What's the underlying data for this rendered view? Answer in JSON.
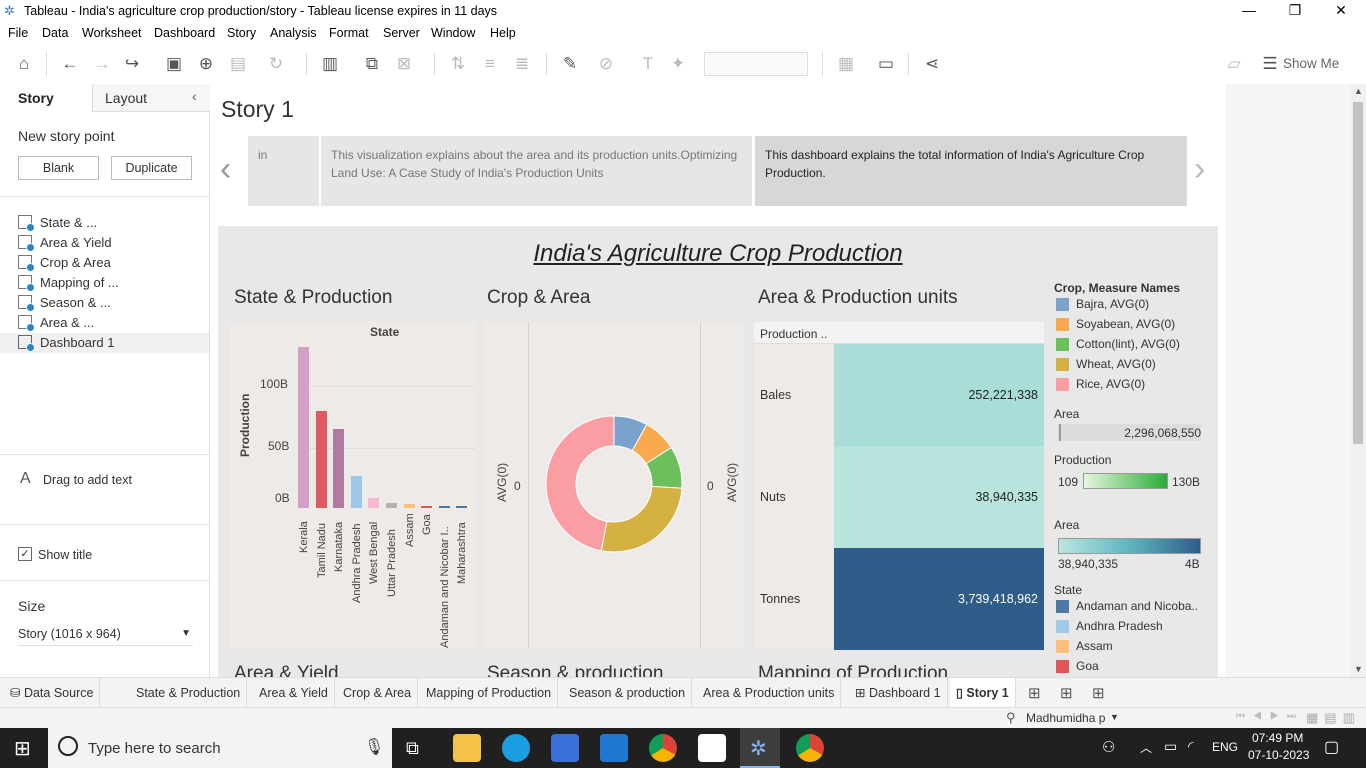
{
  "window": {
    "title": "Tableau - India's agriculture crop production/story - Tableau license expires in 11 days"
  },
  "menu": [
    "File",
    "Data",
    "Worksheet",
    "Dashboard",
    "Story",
    "Analysis",
    "Format",
    "Server",
    "Window",
    "Help"
  ],
  "toolbar": {
    "show_me": "Show Me"
  },
  "left_panel": {
    "tab_story": "Story",
    "tab_layout": "Layout",
    "new_story_point": "New story point",
    "blank_button": "Blank",
    "duplicate_button": "Duplicate",
    "sheets": [
      "State & ...",
      "Area & Yield",
      "Crop & Area",
      "Mapping of ...",
      "Season & ...",
      "Area & ...",
      "Dashboard 1"
    ],
    "drag_text": "Drag to add text",
    "show_title": "Show title",
    "size_label": "Size",
    "size_value": "Story (1016 x 964)"
  },
  "story": {
    "title": "Story 1",
    "caption_partial": "in",
    "caption_2": "This visualization explains about the area and its production units.Optimizing Land Use: A Case Study of India's Production Units",
    "caption_3": "This dashboard explains the total information of India's Agriculture Crop Production."
  },
  "dashboard": {
    "title": "India's Agriculture Crop Production",
    "sheet1_title": "State & Production",
    "sheet2_title": "Crop & Area",
    "sheet3_title": "Area & Production units",
    "bottom_titles": [
      "Area & Yield",
      "Season & production",
      "Mapping of Production"
    ]
  },
  "chart_data": [
    {
      "type": "bar",
      "title": "State & Production",
      "header": "State",
      "ylabel": "Production",
      "yticks": [
        "100B",
        "50B",
        "0B"
      ],
      "ylim": [
        0,
        130
      ],
      "categories": [
        "Kerala",
        "Tamil Nadu",
        "Karnataka",
        "Andhra Pradesh",
        "West Bengal",
        "Uttar Pradesh",
        "Assam",
        "Goa",
        "Andaman and Nicobar I..",
        "Maharashtra"
      ],
      "values": [
        129,
        78,
        63,
        26,
        8,
        4,
        3,
        2,
        2,
        1
      ],
      "colors": [
        "#d4a0c8",
        "#e05a64",
        "#b07aa1",
        "#9dc7e8",
        "#f7b6d2",
        "#bab0ac",
        "#ffbe7d",
        "#e15759",
        "#4e79a7",
        "#4e79a7"
      ]
    },
    {
      "type": "pie",
      "title": "Crop & Area",
      "axis_left": "AVG(0)",
      "axis_right": "AVG(0)",
      "zero_left": "0",
      "zero_right": "0",
      "categories": [
        "Bajra",
        "Soyabean",
        "Cotton(lint)",
        "Wheat",
        "Rice"
      ],
      "values": [
        8,
        8,
        10,
        27,
        47
      ],
      "colors": [
        "#7aa3cc",
        "#f9a94e",
        "#6cbf5c",
        "#d5b043",
        "#fb9ea4"
      ]
    },
    {
      "type": "table",
      "title": "Area & Production units",
      "header": "Production ..",
      "rows": [
        {
          "label": "Bales",
          "value": "252,221,338",
          "color": "#a9ded8"
        },
        {
          "label": "Nuts",
          "value": "38,940,335",
          "color": "#b7e4dc"
        },
        {
          "label": "Tonnes",
          "value": "3,739,418,962",
          "color": "#2f5d8a"
        }
      ]
    }
  ],
  "legends": {
    "crop_title": "Crop, Measure Names",
    "crop_items": [
      {
        "label": "Bajra, AVG(0)",
        "color": "#7aa3cc"
      },
      {
        "label": "Soyabean, AVG(0)",
        "color": "#f9a94e"
      },
      {
        "label": "Cotton(lint), AVG(0)",
        "color": "#6cbf5c"
      },
      {
        "label": "Wheat, AVG(0)",
        "color": "#d5b043"
      },
      {
        "label": "Rice, AVG(0)",
        "color": "#fb9ea4"
      }
    ],
    "area_title": "Area",
    "area_value": "2,296,068,550",
    "production_title": "Production",
    "production_min": "109",
    "production_max": "130B",
    "area2_title": "Area",
    "area2_min": "38,940,335",
    "area2_max": "4B",
    "state_title": "State",
    "state_items": [
      {
        "label": "Andaman and Nicoba..",
        "color": "#4e79a7"
      },
      {
        "label": "Andhra Pradesh",
        "color": "#a0cbe8"
      },
      {
        "label": "Assam",
        "color": "#ffbe7d"
      },
      {
        "label": "Goa",
        "color": "#e15759"
      }
    ]
  },
  "sheet_tabs": [
    "Data Source",
    "State & Production",
    "Area & Yield",
    "Crop & Area",
    "Mapping of Production",
    "Season & production",
    "Area & Production units",
    "Dashboard 1",
    "Story 1"
  ],
  "status": {
    "user": "Madhumidha p"
  },
  "taskbar": {
    "search_placeholder": "Type here to search",
    "lang": "ENG",
    "time": "07:49 PM",
    "date": "07-10-2023"
  }
}
